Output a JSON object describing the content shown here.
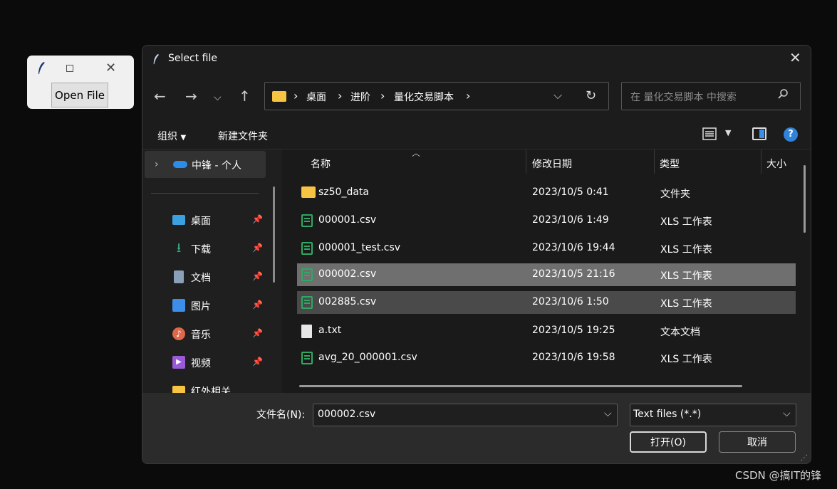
{
  "tk_window": {
    "open_button": "Open File"
  },
  "dialog": {
    "title": "Select file",
    "breadcrumb": [
      "桌面",
      "进阶",
      "量化交易脚本"
    ],
    "search_placeholder": "在 量化交易脚本 中搜索",
    "toolbar": {
      "organize": "组织",
      "new_folder": "新建文件夹"
    },
    "sidebar": {
      "onedrive": "中锋 - 个人",
      "items": [
        {
          "label": "桌面",
          "icon": "desktop-icon",
          "color": "#3aa0e0"
        },
        {
          "label": "下载",
          "icon": "download-icon",
          "color": "#2fb380"
        },
        {
          "label": "文档",
          "icon": "documents-icon",
          "color": "#8aa0b8"
        },
        {
          "label": "图片",
          "icon": "pictures-icon",
          "color": "#3d8ee8"
        },
        {
          "label": "音乐",
          "icon": "music-icon",
          "color": "#e0684a"
        },
        {
          "label": "视频",
          "icon": "videos-icon",
          "color": "#9a5ad8"
        },
        {
          "label": "红外相关",
          "icon": "folder-icon",
          "color": "#f7c343"
        }
      ]
    },
    "columns": [
      "名称",
      "修改日期",
      "类型",
      "大小"
    ],
    "files": [
      {
        "name": "sz50_data",
        "date": "2023/10/5 0:41",
        "type": "文件夹",
        "icon": "folder-icon"
      },
      {
        "name": "000001.csv",
        "date": "2023/10/6 1:49",
        "type": "XLS 工作表",
        "icon": "csv-icon"
      },
      {
        "name": "000001_test.csv",
        "date": "2023/10/6 19:44",
        "type": "XLS 工作表",
        "icon": "csv-icon"
      },
      {
        "name": "000002.csv",
        "date": "2023/10/5 21:16",
        "type": "XLS 工作表",
        "icon": "csv-icon",
        "state": "selected"
      },
      {
        "name": "002885.csv",
        "date": "2023/10/6 1:50",
        "type": "XLS 工作表",
        "icon": "csv-icon",
        "state": "hover"
      },
      {
        "name": "a.txt",
        "date": "2023/10/5 19:25",
        "type": "文本文档",
        "icon": "text-file-icon"
      },
      {
        "name": "avg_20_000001.csv",
        "date": "2023/10/6 19:58",
        "type": "XLS 工作表",
        "icon": "csv-icon"
      }
    ],
    "filename_label": "文件名(N):",
    "filename_value": "000002.csv",
    "filter_value": "Text files (*.*)",
    "open_button": "打开(O)",
    "cancel_button": "取消"
  },
  "watermark": "CSDN @搞IT的锋"
}
